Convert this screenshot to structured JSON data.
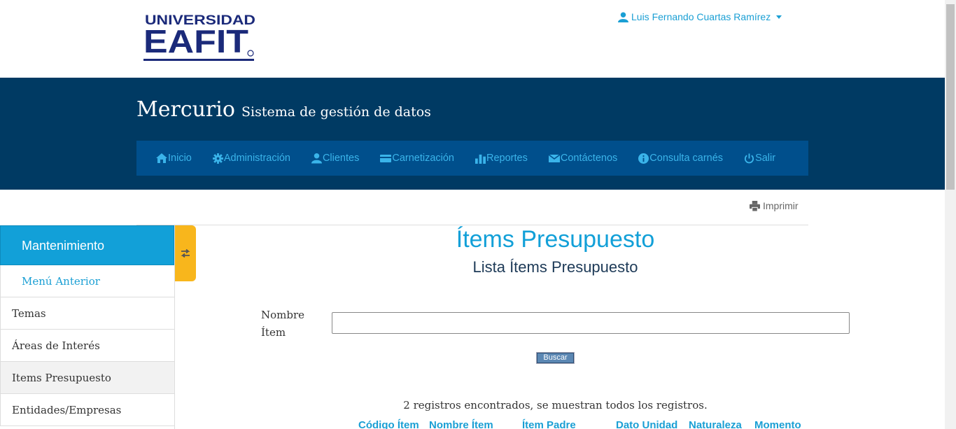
{
  "header": {
    "logo_line1": "UNIVERSIDAD",
    "logo_line2": "EAFIT",
    "user_name": "Luis Fernando Cuartas Ramírez"
  },
  "banner": {
    "app_name": "Mercurio",
    "app_subtitle": "Sistema de gestión de datos"
  },
  "nav": {
    "items": [
      {
        "label": "Inicio",
        "icon": "home-icon"
      },
      {
        "label": "Administración",
        "icon": "gear-icon"
      },
      {
        "label": "Clientes",
        "icon": "user-icon"
      },
      {
        "label": "Carnetización",
        "icon": "card-icon"
      },
      {
        "label": "Reportes",
        "icon": "bar-chart-icon"
      },
      {
        "label": "Contáctenos",
        "icon": "envelope-icon"
      },
      {
        "label": "Consulta carnés",
        "icon": "info-icon"
      },
      {
        "label": "Salir",
        "icon": "power-icon"
      }
    ]
  },
  "toolbar": {
    "print_label": "Imprimir"
  },
  "sidebar": {
    "title": "Mantenimiento",
    "items": [
      {
        "label": "Menú Anterior"
      },
      {
        "label": "Temas"
      },
      {
        "label": "Áreas de Interés"
      },
      {
        "label": "Items Presupuesto"
      },
      {
        "label": "Entidades/Empresas"
      }
    ]
  },
  "main": {
    "title": "Ítems Presupuesto",
    "subtitle": "Lista Ítems Presupuesto",
    "filter_label": "Nombre Ítem",
    "filter_value": "",
    "search_button": "Buscar",
    "records_text": "2 registros encontrados, se muestran todos los registros.",
    "columns": [
      "Código Ítem",
      "Nombre Ítem",
      "Ítem Padre",
      "Dato Unidad",
      "Naturaleza",
      "Momento"
    ]
  },
  "colors": {
    "banner": "#003a63",
    "navbar": "#004f8c",
    "accent": "#12a0d8",
    "toggle": "#f8b61c"
  }
}
